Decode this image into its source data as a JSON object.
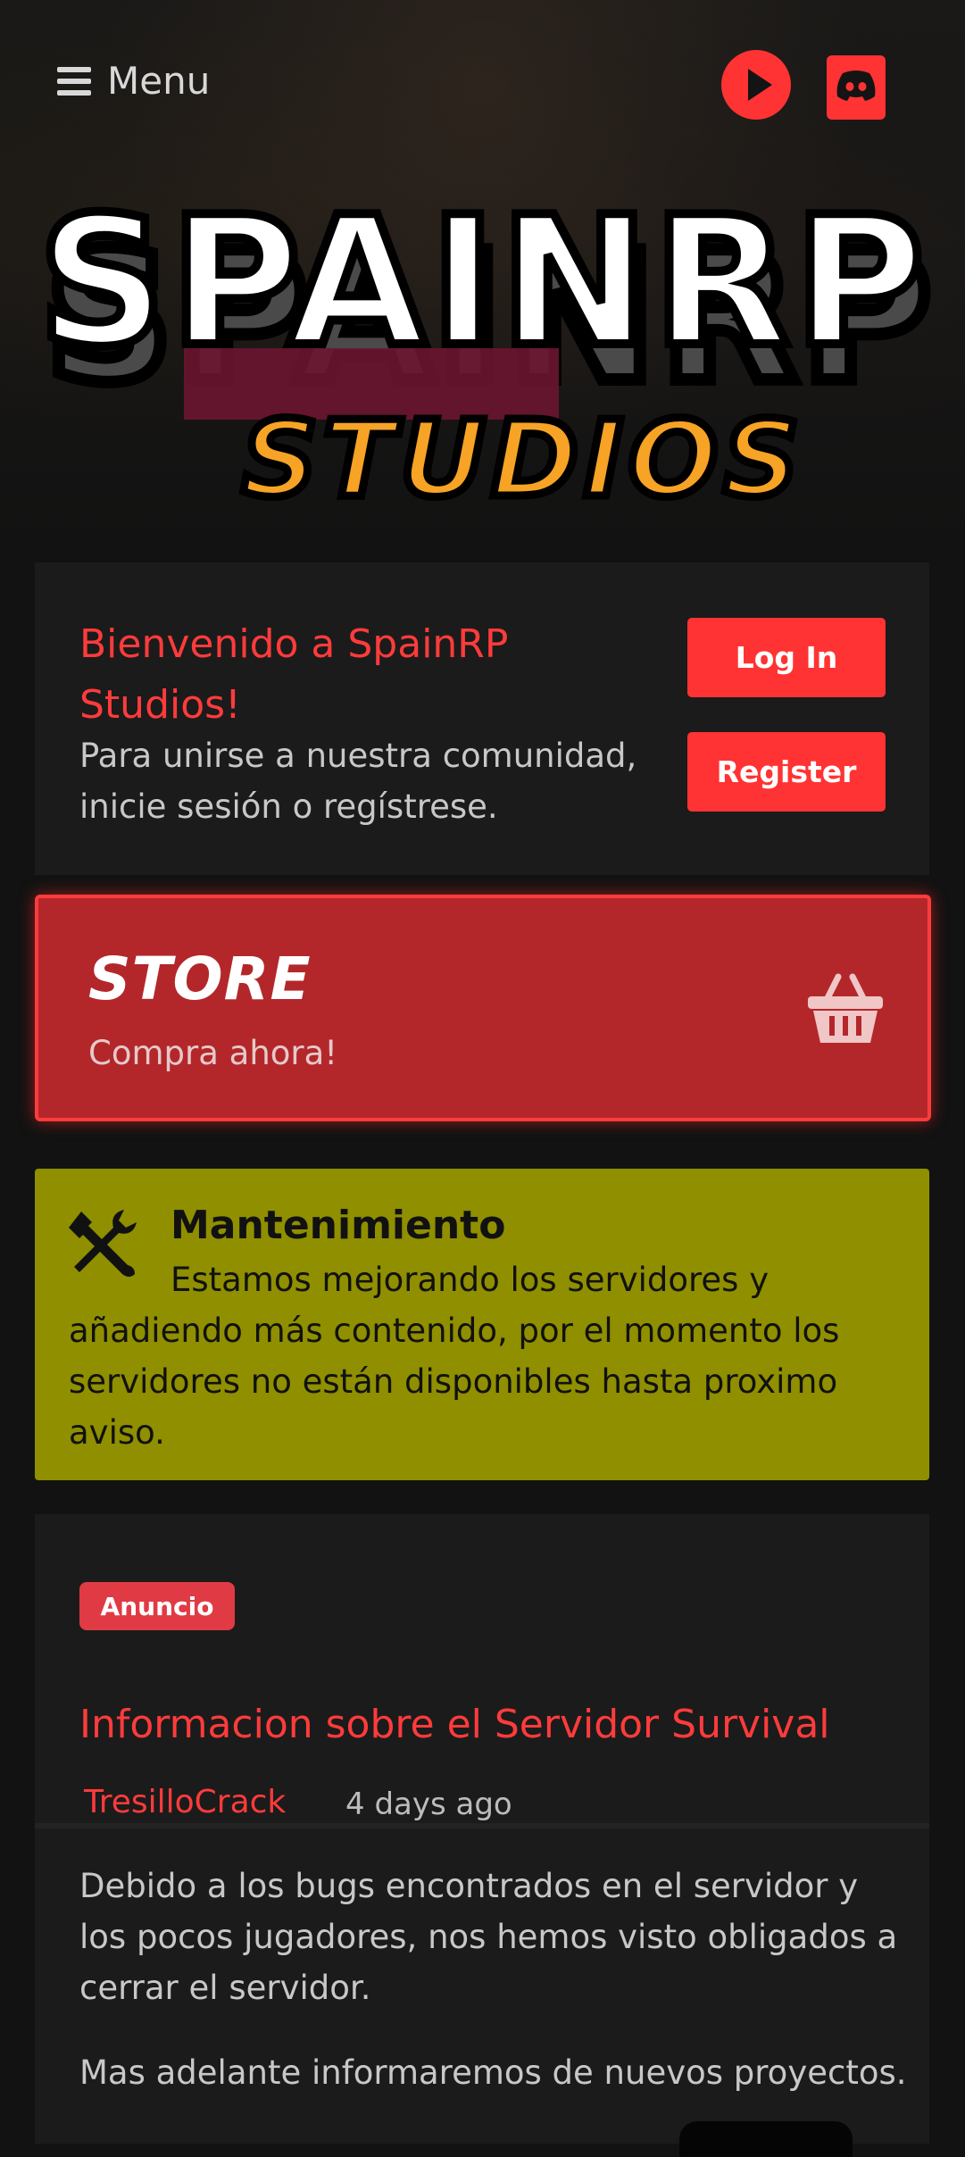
{
  "header": {
    "menu_label": "Menu",
    "menu_icon": "hamburger-icon",
    "play_icon": "play-icon",
    "discord_icon": "discord-icon"
  },
  "logo": {
    "line1": "SPAINRP",
    "line2": "STUDIOS"
  },
  "welcome": {
    "title": "Bienvenido a SpainRP Studios!",
    "text": "Para unirse a nuestra comunidad, inicie sesión o regístrese.",
    "login_label": "Log In",
    "register_label": "Register"
  },
  "store": {
    "title": "STORE",
    "subtitle": "Compra ahora!",
    "icon": "basket-icon"
  },
  "maintenance": {
    "title": "Mantenimiento",
    "text": "Estamos mejorando los servidores y añadiendo más contenido, por el momento los servidores no están disponibles hasta proximo aviso.",
    "icon": "tools-icon"
  },
  "post": {
    "badge": "Anuncio",
    "title": "Informacion sobre el Servidor Survival",
    "author": "TresilloCrack",
    "time": "4 days ago",
    "paragraphs": [
      "Debido a los bugs encontrados en el servidor y los pocos jugadores, nos hemos visto obligados a cerrar el servidor.",
      "Mas adelante informaremos de nuevos proyectos."
    ]
  },
  "colors": {
    "accent": "#ff3333",
    "store_bg": "#b3272b",
    "maintenance_bg": "#8f8f00",
    "card_bg": "#1b1b1b",
    "page_bg": "#121212"
  }
}
